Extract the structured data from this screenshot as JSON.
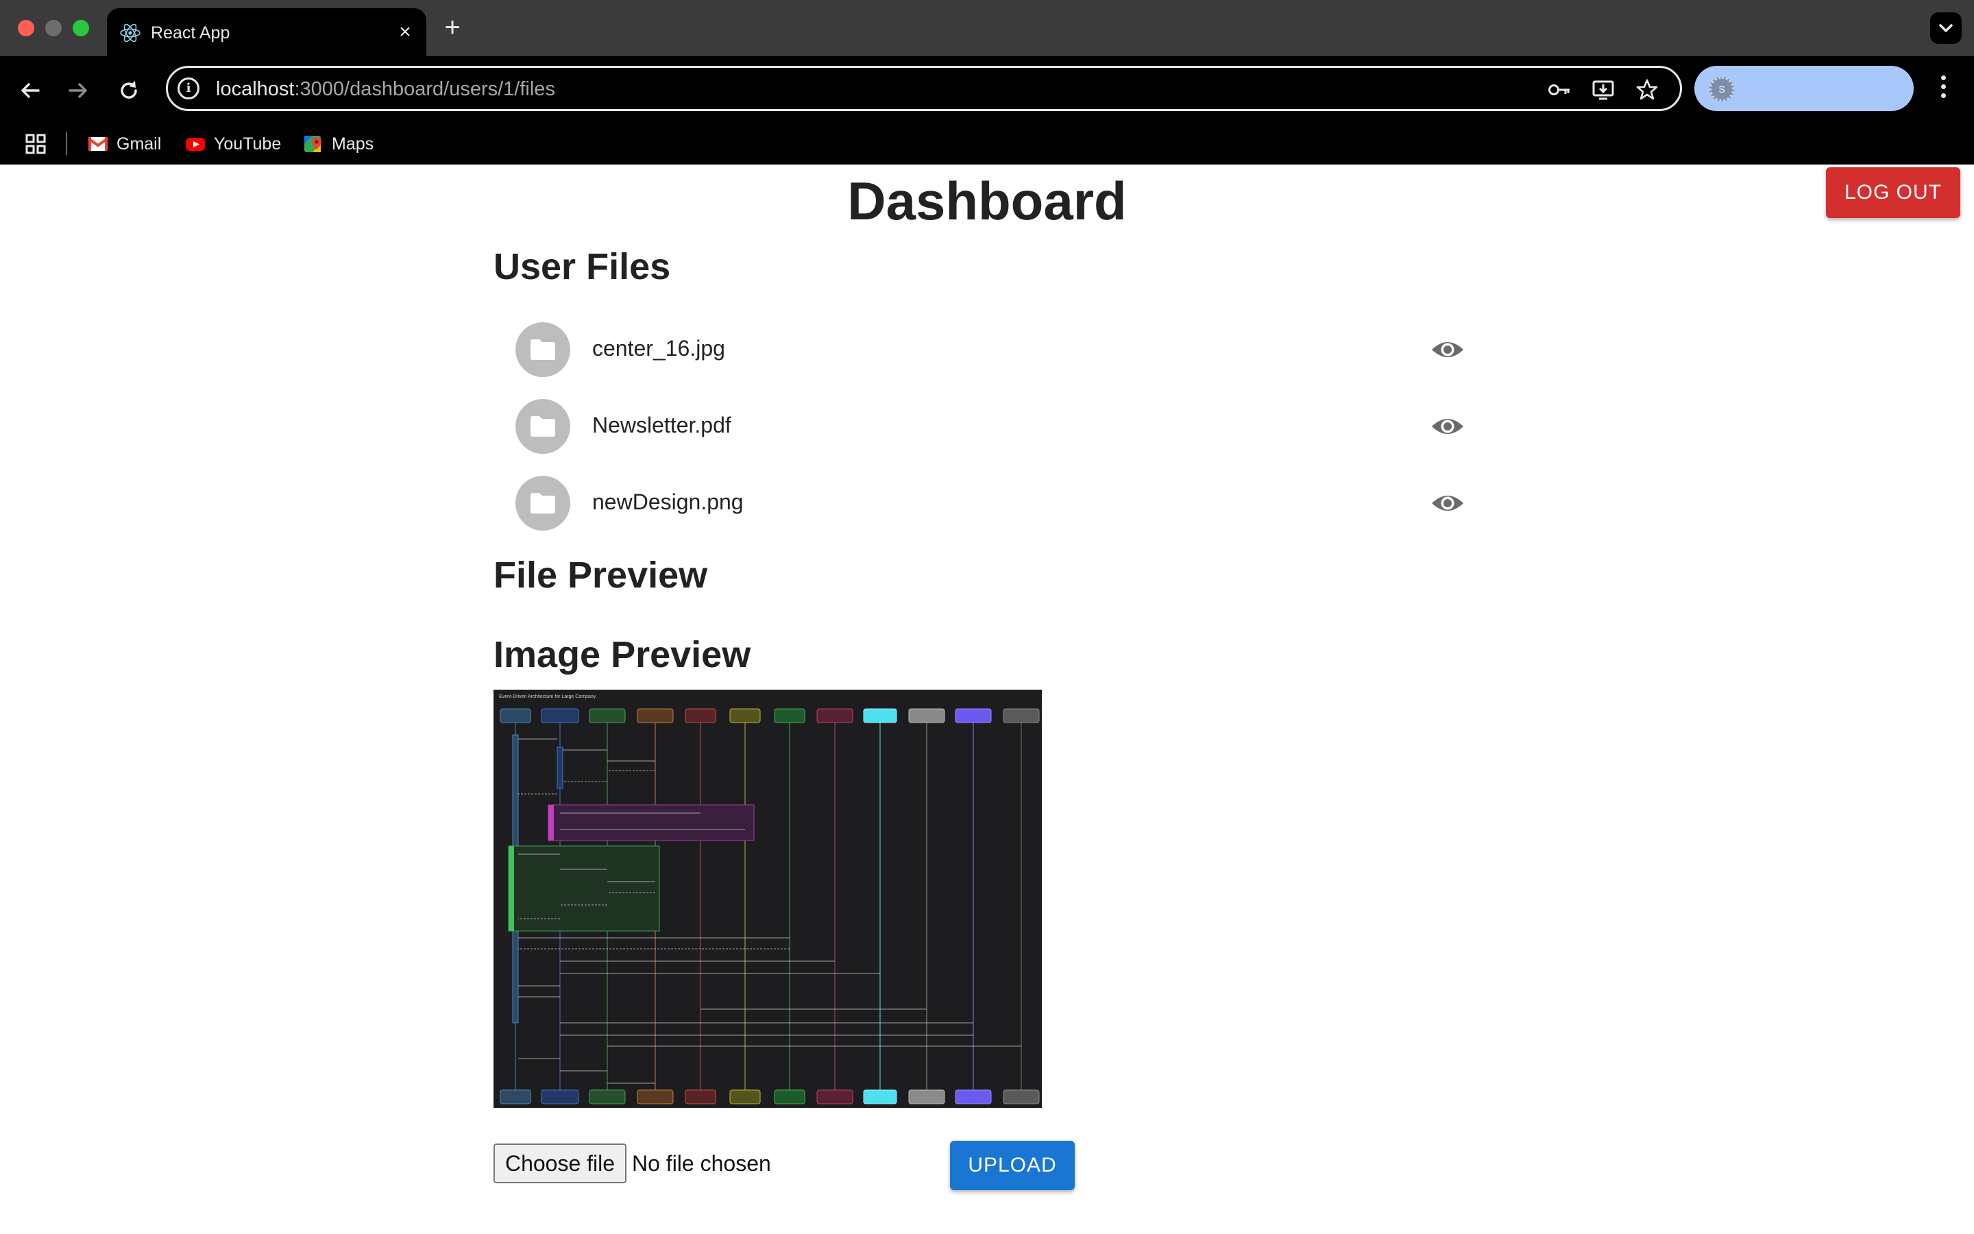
{
  "browser": {
    "tab_title": "React App",
    "tab_close": "×",
    "new_tab": "+",
    "url_host": "localhost",
    "url_path": ":3000/dashboard/users/1/files",
    "profile_initial": "S",
    "bookmarks": [
      {
        "label": "Gmail",
        "icon": "gmail-icon"
      },
      {
        "label": "YouTube",
        "icon": "youtube-icon"
      },
      {
        "label": "Maps",
        "icon": "maps-icon"
      }
    ]
  },
  "header": {
    "title": "Dashboard",
    "logout_label": "LOG OUT"
  },
  "files_section": {
    "heading": "User Files",
    "files": [
      {
        "name": "center_16.jpg",
        "icon": "folder-icon",
        "action_icon": "eye-icon"
      },
      {
        "name": "Newsletter.pdf",
        "icon": "folder-icon",
        "action_icon": "eye-icon"
      },
      {
        "name": "newDesign.png",
        "icon": "folder-icon",
        "action_icon": "eye-icon"
      }
    ]
  },
  "preview": {
    "file_preview_heading": "File Preview",
    "image_preview_heading": "Image Preview",
    "image_caption": "Event-Driven Architecture for Large Company"
  },
  "upload": {
    "choose_label": "Choose file",
    "no_file_text": "No file chosen",
    "upload_label": "UPLOAD"
  },
  "colors": {
    "logout": "#d32f2f",
    "upload": "#1976d2",
    "profile_pill": "#a8c7fa"
  }
}
